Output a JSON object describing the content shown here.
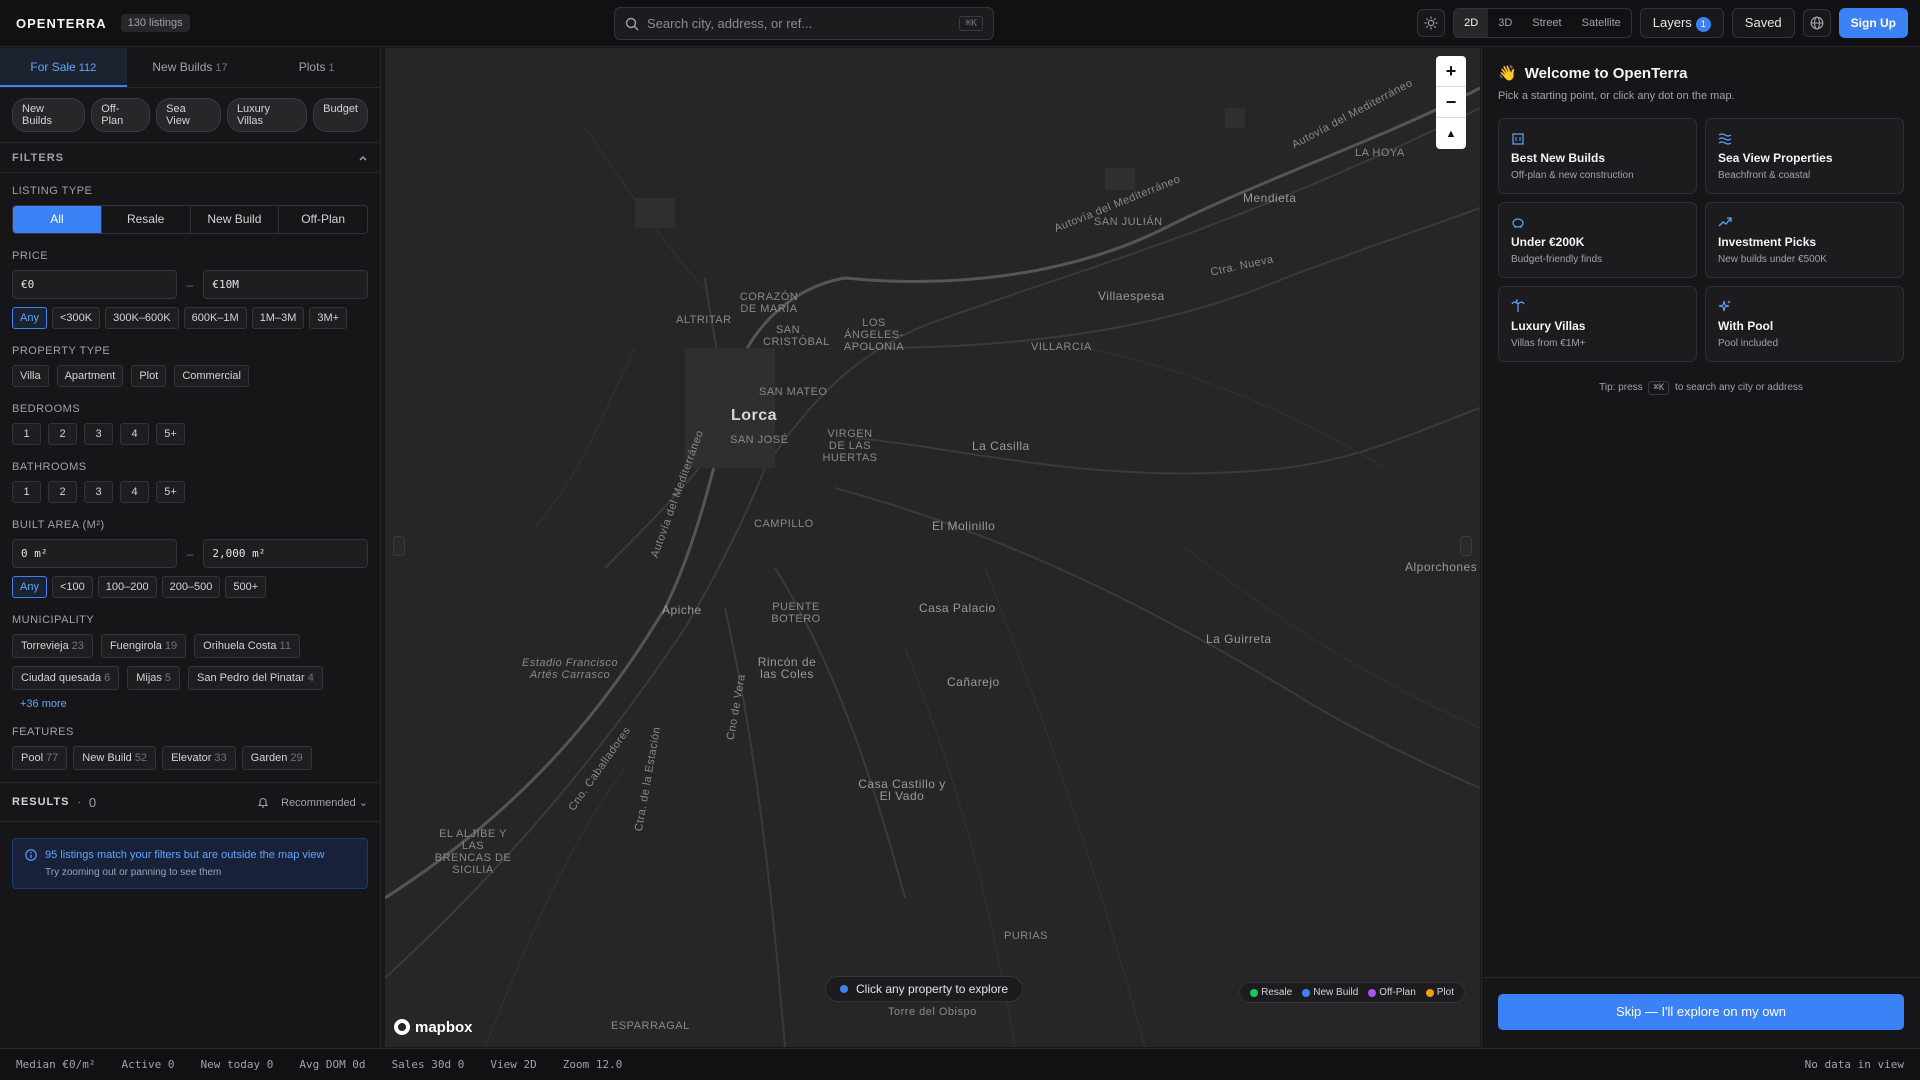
{
  "header": {
    "logo": "OPENTERRA",
    "listings_badge": "130 listings",
    "search_placeholder": "Search city, address, or ref...",
    "search_shortcut": "⌘K",
    "view_modes": [
      "2D",
      "3D",
      "Street",
      "Satellite"
    ],
    "active_view": "2D",
    "layers_label": "Layers",
    "layers_count": "1",
    "saved_label": "Saved",
    "signup_label": "Sign Up"
  },
  "sidebar": {
    "tabs": [
      {
        "label": "For Sale",
        "count": "112",
        "active": true
      },
      {
        "label": "New Builds",
        "count": "17",
        "active": false
      },
      {
        "label": "Plots",
        "count": "1",
        "active": false
      }
    ],
    "quick_chips": [
      "New Builds",
      "Off-Plan",
      "Sea View",
      "Luxury Villas",
      "Budget"
    ],
    "filters_title": "FILTERS",
    "listing_type": {
      "label": "LISTING TYPE",
      "options": [
        "All",
        "Resale",
        "New Build",
        "Off-Plan"
      ],
      "active": "All"
    },
    "price": {
      "label": "PRICE",
      "min": "€0",
      "max": "€10M",
      "presets": [
        "Any",
        "<300K",
        "300K–600K",
        "600K–1M",
        "1M–3M",
        "3M+"
      ],
      "active": "Any"
    },
    "property_type": {
      "label": "PROPERTY TYPE",
      "options": [
        "Villa",
        "Apartment",
        "Plot",
        "Commercial"
      ]
    },
    "bedrooms": {
      "label": "BEDROOMS",
      "options": [
        "1",
        "2",
        "3",
        "4",
        "5+"
      ]
    },
    "bathrooms": {
      "label": "BATHROOMS",
      "options": [
        "1",
        "2",
        "3",
        "4",
        "5+"
      ]
    },
    "built_area": {
      "label": "BUILT AREA (M²)",
      "min": "0 m²",
      "max": "2,000 m²",
      "presets": [
        "Any",
        "<100",
        "100–200",
        "200–500",
        "500+"
      ],
      "active": "Any"
    },
    "municipality": {
      "label": "MUNICIPALITY",
      "items": [
        {
          "name": "Torrevieja",
          "count": "23"
        },
        {
          "name": "Fuengirola",
          "count": "19"
        },
        {
          "name": "Orihuela Costa",
          "count": "11"
        },
        {
          "name": "Ciudad quesada",
          "count": "6"
        },
        {
          "name": "Mijas",
          "count": "5"
        },
        {
          "name": "San Pedro del Pinatar",
          "count": "4"
        }
      ],
      "more": "+36 more"
    },
    "features": {
      "label": "FEATURES",
      "items": [
        {
          "name": "Pool",
          "count": "77"
        },
        {
          "name": "New Build",
          "count": "52"
        },
        {
          "name": "Elevator",
          "count": "33"
        },
        {
          "name": "Garden",
          "count": "29"
        }
      ]
    },
    "results": {
      "label": "RESULTS",
      "sep": "·",
      "count": "0",
      "sort": "Recommended"
    },
    "notice": {
      "title": "95 listings match your filters but are outside the map view",
      "subtitle": "Try zooming out or panning to see them"
    }
  },
  "map": {
    "labels": {
      "lorca": "Lorca",
      "san_mateo": "SAN MATEO",
      "san_jose": "SAN JOSÉ",
      "corazon": "CORAZÓN DE MARÍA",
      "san_cristobal": "SAN CRISTÓBAL",
      "los_angeles": "LOS ÁNGELES-APOLONIA",
      "altritar": "ALTRITAR",
      "virgen": "VIRGEN DE LAS HUERTAS",
      "campillo": "CAMPILLO",
      "la_casilla": "La Casilla",
      "el_molinillo": "El Molinillo",
      "casa_palacio": "Casa Palacio",
      "apiche": "Apiche",
      "puente_botero": "PUENTE BOTERO",
      "estadio": "Estadio Francisco Artés Carrasco",
      "rincon": "Rincón de las Coles",
      "canarejo": "Cañarejo",
      "casa_castillo": "Casa Castillo y El Vado",
      "la_guirreta": "La Guirreta",
      "alporchones": "Alporchones",
      "villaespesa": "Villaespesa",
      "villarcia": "VILLARCIA",
      "mendieta": "Mendieta",
      "la_hoya": "LA HOYA",
      "san_julian": "SAN JULIÁN",
      "el_aljibe": "EL ALJIBE Y LAS BRENCAS DE SICILIA",
      "purias": "PURIAS",
      "esparragal": "ESPARRAGAL",
      "torre_obispo": "Torre del Obispo",
      "autovia1": "Autovía del Mediterráneo",
      "autovia2": "Autovía del Mediterráneo",
      "autovia3": "Autovía del Mediterráneo",
      "ctra_nueva": "Ctra. Nueva",
      "cno_caballadores": "Cno. Caballadores",
      "cno_vera": "Cno de Vera",
      "ctra_estacion": "Ctra. de la Estación"
    },
    "zoom_in": "+",
    "zoom_out": "−",
    "compass": "▲",
    "toast": "Click any property to explore",
    "legend": [
      {
        "label": "Resale",
        "color": "#22c55e"
      },
      {
        "label": "New Build",
        "color": "#3b82f6"
      },
      {
        "label": "Off-Plan",
        "color": "#a855f7"
      },
      {
        "label": "Plot",
        "color": "#f59e0b"
      }
    ],
    "attribution": "mapbox"
  },
  "welcome": {
    "emoji": "👋",
    "title": "Welcome to OpenTerra",
    "subtitle": "Pick a starting point, or click any dot on the map.",
    "cards": [
      {
        "icon": "building-icon",
        "title": "Best New Builds",
        "subtitle": "Off-plan & new construction"
      },
      {
        "icon": "waves-icon",
        "title": "Sea View Properties",
        "subtitle": "Beachfront & coastal"
      },
      {
        "icon": "piggy-bank-icon",
        "title": "Under €200K",
        "subtitle": "Budget-friendly finds"
      },
      {
        "icon": "trending-up-icon",
        "title": "Investment Picks",
        "subtitle": "New builds under €500K"
      },
      {
        "icon": "palm-tree-icon",
        "title": "Luxury Villas",
        "subtitle": "Villas from €1M+"
      },
      {
        "icon": "sparkles-icon",
        "title": "With Pool",
        "subtitle": "Pool included"
      }
    ],
    "tip_prefix": "Tip: press",
    "tip_key": "⌘K",
    "tip_suffix": "to search any city or address",
    "skip_label": "Skip — I'll explore on my own"
  },
  "statusbar": {
    "median": "Median €0/m²",
    "active": "Active 0",
    "new_today": "New today 0",
    "avg_dom": "Avg DOM 0d",
    "sales": "Sales 30d 0",
    "view": "View 2D",
    "zoom": "Zoom 12.0",
    "no_data": "No data in view"
  }
}
